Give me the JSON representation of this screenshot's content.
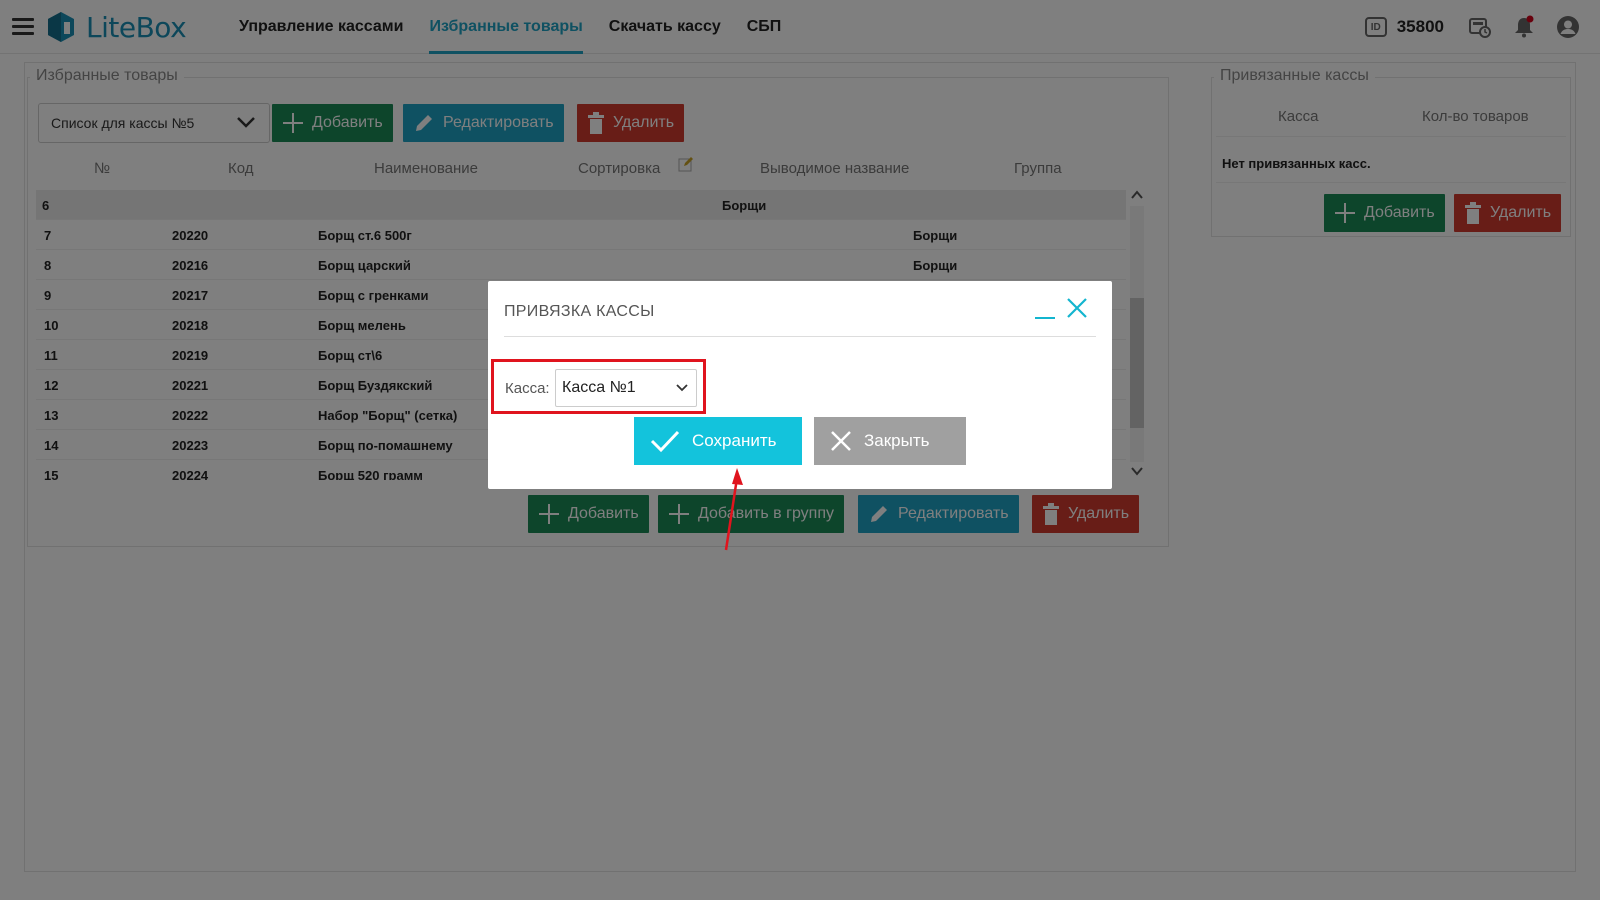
{
  "app": {
    "logo_text": "LiteBox"
  },
  "nav": {
    "items": [
      {
        "label": "Управление кассами"
      },
      {
        "label": "Избранные товары"
      },
      {
        "label": "Скачать кассу"
      },
      {
        "label": "СБП"
      }
    ],
    "active_index": 1
  },
  "top_right": {
    "id_label": "ID",
    "id_value": "35800"
  },
  "left_panel": {
    "legend": "Избранные товары",
    "list_select": "Список для кассы №5",
    "top_buttons": {
      "add": "Добавить",
      "edit": "Редактировать",
      "delete": "Удалить"
    },
    "columns": [
      "№",
      "Код",
      "Наименование",
      "Сортировка",
      "Выводимое название",
      "Группа"
    ],
    "group_row": {
      "num": "6",
      "name": "Борщи"
    },
    "rows": [
      {
        "num": "7",
        "code": "20220",
        "name": "Борщ ст.6 500г",
        "group": "Борщи"
      },
      {
        "num": "8",
        "code": "20216",
        "name": "Борщ царский",
        "group": "Борщи"
      },
      {
        "num": "9",
        "code": "20217",
        "name": "Борщ с гренками",
        "group": ""
      },
      {
        "num": "10",
        "code": "20218",
        "name": "Борщ мелень",
        "group": ""
      },
      {
        "num": "11",
        "code": "20219",
        "name": "Борщ ст\\6",
        "group": ""
      },
      {
        "num": "12",
        "code": "20221",
        "name": "Борщ Буздякский",
        "group": ""
      },
      {
        "num": "13",
        "code": "20222",
        "name": "Набор \"Борщ\" (сетка)",
        "group": ""
      },
      {
        "num": "14",
        "code": "20223",
        "name": "Борщ по-помашнему",
        "group": ""
      },
      {
        "num": "15",
        "code": "20224",
        "name": "Борщ 520 грамм",
        "group": ""
      }
    ],
    "bottom_buttons": {
      "add": "Добавить",
      "add_to_group": "Добавить в группу",
      "edit": "Редактировать",
      "delete": "Удалить"
    }
  },
  "right_panel": {
    "legend": "Привязанные кассы",
    "columns": [
      "Касса",
      "Кол-во товаров"
    ],
    "empty_text": "Нет привязанных касс.",
    "buttons": {
      "add": "Добавить",
      "delete": "Удалить"
    }
  },
  "modal": {
    "title": "ПРИВЯЗКА КАССЫ",
    "kassa_label": "Касса:",
    "kassa_value": "Касса №1",
    "save": "Сохранить",
    "close": "Закрыть"
  },
  "colors": {
    "accent": "#1fa2c4",
    "green": "#1a8a57",
    "red": "#d13a2e",
    "save": "#13c3dc",
    "highlight": "#e0141e"
  },
  "icons": [
    "menu-icon",
    "litebox-logo-icon",
    "id-icon",
    "cash-register-icon",
    "bell-icon",
    "user-icon",
    "chevron-down-icon",
    "plus-icon",
    "pencil-icon",
    "trash-icon",
    "minimize-icon",
    "close-icon",
    "check-icon"
  ]
}
